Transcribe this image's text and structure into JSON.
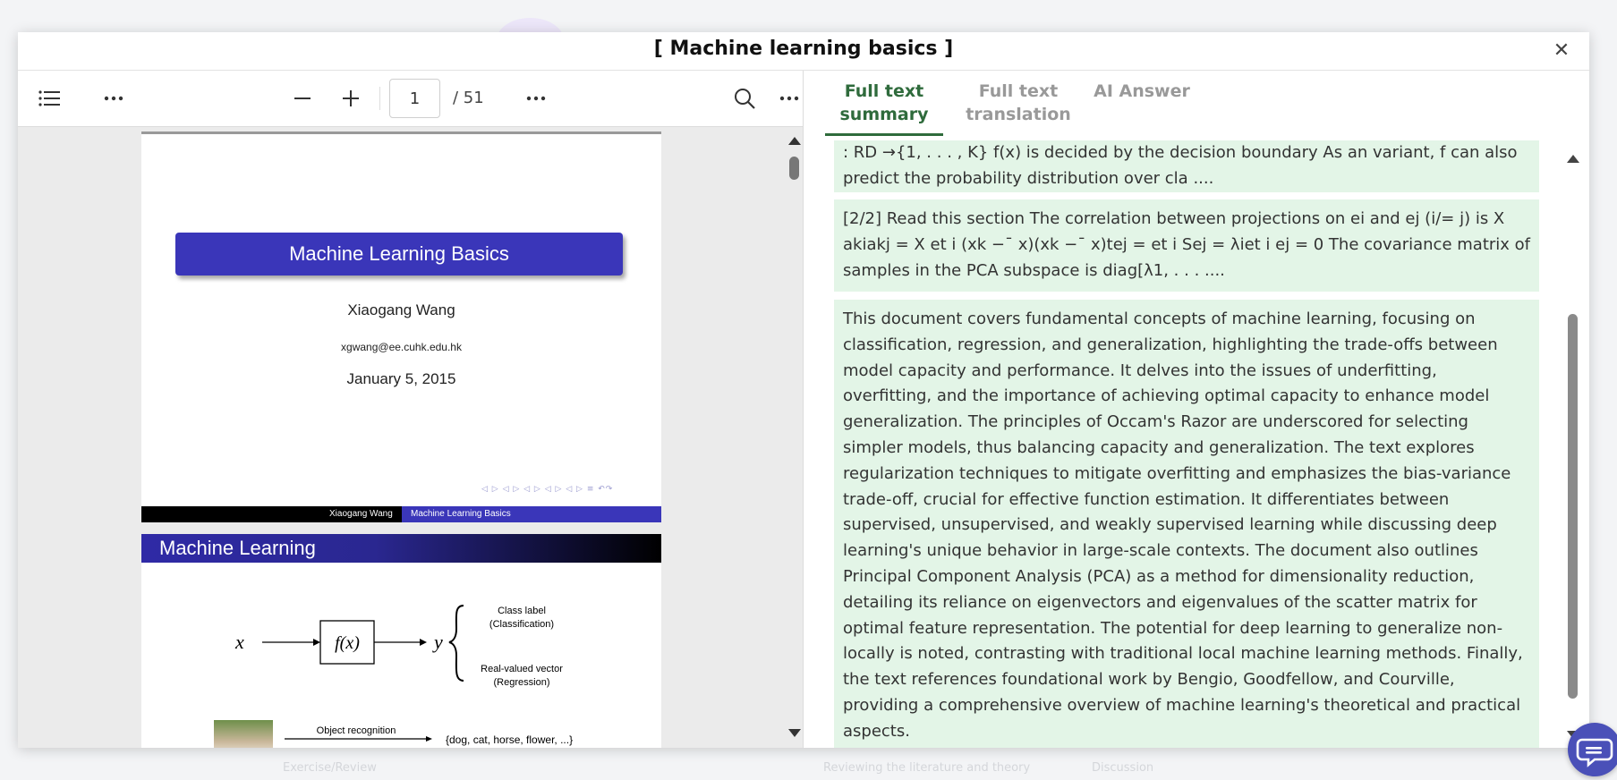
{
  "background": {
    "texts": [
      "Exercise/Review",
      "Reviewing the literature and theory",
      "Discussion"
    ]
  },
  "modal": {
    "title": "[ Machine learning basics ]",
    "close_icon": "close-icon"
  },
  "viewer": {
    "toolbar": {
      "outline_icon": "list-icon",
      "more_icon": "more-horizontal-icon",
      "zoom_out_icon": "minus-icon",
      "zoom_in_icon": "plus-icon",
      "page_value": "1",
      "page_total": "/ 51",
      "search_icon": "search-icon"
    },
    "slide1": {
      "title": "Machine Learning Basics",
      "author": "Xiaogang Wang",
      "email": "xgwang@ee.cuhk.edu.hk",
      "date": "January 5, 2015",
      "nav": "◁ ▷ ◁ ▷ ◁ ▷ ◁ ▷ ◁ ▷   ≡   ↶↷",
      "footer_author": "Xiaogang Wang",
      "footer_title": "Machine Learning Basics"
    },
    "slide2": {
      "title": "Machine Learning",
      "x": "x",
      "f": "f(x)",
      "y": "y",
      "class_label_1": "Class label",
      "class_label_2": "(Classification)",
      "real_1": "Real-valued vector",
      "real_2": "(Regression)",
      "object_recognition": "Object recognition",
      "classes": "{dog, cat, horse, flower, ...}"
    }
  },
  "panel": {
    "tabs": [
      {
        "line1": "Full text",
        "line2": "summary",
        "active": true
      },
      {
        "line1": "Full text",
        "line2": "translation",
        "active": false
      },
      {
        "line1": "AI Answer",
        "line2": "",
        "active": false
      }
    ],
    "cards": [
      {
        "text": ": RD →{1, . . . , K} f(x) is decided by the decision boundary As an variant, f can also predict the probability distribution over cla ...."
      },
      {
        "text": "[2/2] Read this section The correlation between projections on ei and ej (i/= j) is X akiakj = X et i (xk −¯ x)(xk −¯ x)tej = et i Sej = λiet i ej = 0 The covariance matrix of samples in the PCA subspace is diag[λ1, . . . ...."
      },
      {
        "text": "This document covers fundamental concepts of machine learning, focusing on classification, regression, and generalization, highlighting the trade-offs between model capacity and performance. It delves into the issues of underfitting, overfitting, and the importance of achieving optimal capacity to enhance model generalization. The principles of Occam's Razor are underscored for selecting simpler models, thus balancing capacity and generalization. The text explores regularization techniques to mitigate overfitting and emphasizes the bias-variance trade-off, crucial for effective function estimation. It differentiates between supervised, unsupervised, and weakly supervised learning while discussing deep learning's unique behavior in large-scale contexts. The document also outlines Principal Component Analysis (PCA) as a method for dimensionality reduction, detailing its reliance on eigenvectors and eigenvalues of the scatter matrix for optimal feature representation. The potential for deep learning to generalize non-locally is noted, contrasting with traditional local machine learning methods. Finally, the text references foundational work by Bengio, Goodfellow, and Courville, providing a comprehensive overview of machine learning's theoretical and practical aspects."
      }
    ]
  },
  "chat_icon": "chat-bubble-icon",
  "colors": {
    "accent_green": "#2f6b3c",
    "card_bg": "#e3f5e7",
    "slide_blue": "#3a36b9",
    "fab": "#4a50b8"
  }
}
